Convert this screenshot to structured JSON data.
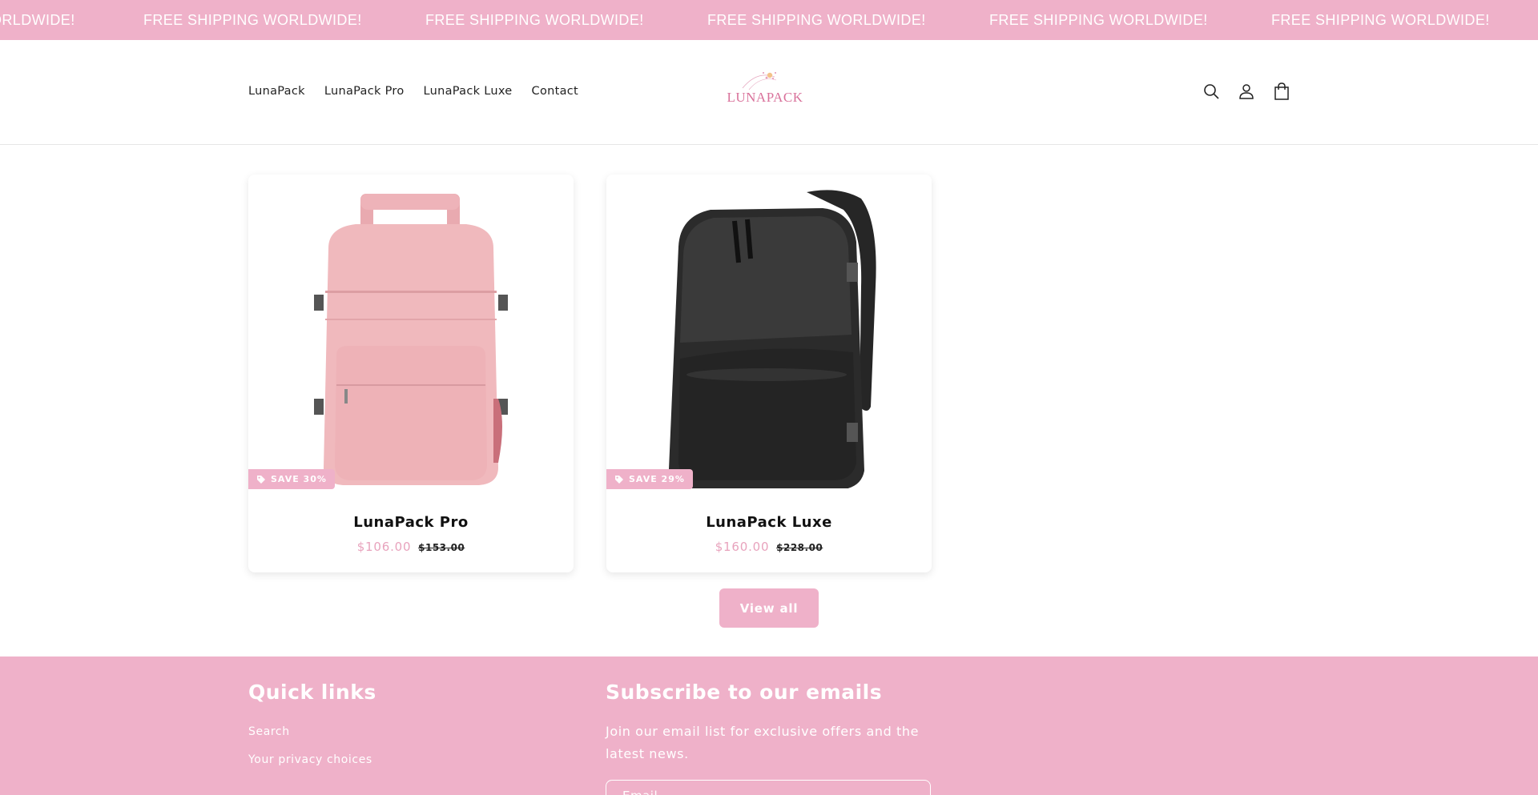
{
  "announcement": {
    "items": [
      "FREE SHIPPING WORLDWIDE!",
      "FREE SHIPPING WORLDWIDE!",
      "FREE SHIPPING WORLDWIDE!",
      "FREE SHIPPING WORLDWIDE!",
      "FREE SHIPPING WORLDWIDE!",
      "FREE SHIPPING WORLDWIDE!"
    ],
    "first_partial": "ORLDWIDE!"
  },
  "header": {
    "nav": [
      "LunaPack",
      "LunaPack Pro",
      "LunaPack Luxe",
      "Contact"
    ],
    "logo_text": "LUNAPACK",
    "icons": [
      "search-icon",
      "account-icon",
      "cart-icon"
    ]
  },
  "products": [
    {
      "title": "LunaPack Pro",
      "badge": "SAVE 30%",
      "price": "$106.00",
      "compare_price": "$153.00",
      "image": "pink-backpack"
    },
    {
      "title": "LunaPack Luxe",
      "badge": "SAVE 29%",
      "price": "$160.00",
      "compare_price": "$228.00",
      "image": "black-backpack"
    }
  ],
  "view_all_label": "View all",
  "footer": {
    "quick_links_heading": "Quick links",
    "links": [
      "Search",
      "Your privacy choices"
    ],
    "subscribe_heading": "Subscribe to our emails",
    "subscribe_text": "Join our email list for exclusive offers and the latest news.",
    "email_placeholder": "Email"
  },
  "colors": {
    "brand_pink": "#efb1c9",
    "price_pink": "#e8a3bd"
  }
}
